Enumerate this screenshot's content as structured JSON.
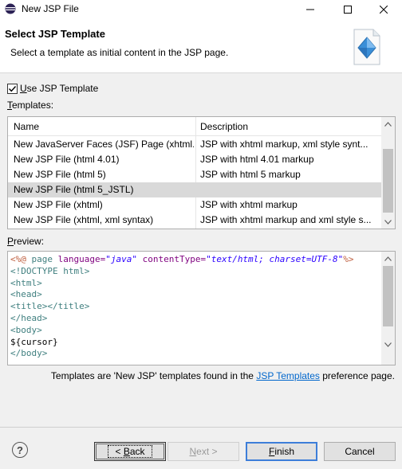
{
  "window": {
    "title": "New JSP File"
  },
  "banner": {
    "heading": "Select JSP Template",
    "description": "Select a template as initial content in the JSP page."
  },
  "use_template": {
    "label_prefix": "U",
    "label_rest": "se JSP Template",
    "checked": true
  },
  "templates_label": {
    "prefix": "T",
    "rest": "emplates:"
  },
  "table": {
    "columns": [
      "Name",
      "Description"
    ],
    "rows": [
      {
        "name": "New JavaServer Faces (JSF) Page (xhtml...",
        "description": "JSP with xhtml markup, xml style synt...",
        "selected": false
      },
      {
        "name": "New JSP File (html 4.01)",
        "description": "JSP with html 4.01 markup",
        "selected": false
      },
      {
        "name": "New JSP File (html 5)",
        "description": "JSP with html 5 markup",
        "selected": false
      },
      {
        "name": "New JSP File (html 5_JSTL)",
        "description": "",
        "selected": true
      },
      {
        "name": "New JSP File (xhtml)",
        "description": "JSP with xhtml markup",
        "selected": false
      },
      {
        "name": "New JSP File (xhtml, xml syntax)",
        "description": "JSP with xhtml markup and xml style s...",
        "selected": false
      }
    ]
  },
  "preview_label": {
    "prefix": "P",
    "rest": "review:"
  },
  "preview": {
    "l1_open": "<%@",
    "l1_kw": " page ",
    "l1_attr1": "language=",
    "l1_val1": "\"java\"",
    "l1_attr2": " contentType=",
    "l1_val2": "\"text/html; charset=UTF-8\"",
    "l1_close": "%>",
    "l2": "<!DOCTYPE html>",
    "l3": "<html>",
    "l4": "<head>",
    "l5": "<title></title>",
    "l6": "</head>",
    "l7": "<body>",
    "l8": "${cursor}",
    "l9": "</body>"
  },
  "info": {
    "before": "Templates are 'New JSP' templates found in the ",
    "link": "JSP Templates",
    "after": " preference page."
  },
  "buttons": {
    "back": {
      "prefix": "< ",
      "mnemonic": "B",
      "rest": "ack"
    },
    "next": {
      "mnemonic": "N",
      "rest": "ext >"
    },
    "finish": {
      "mnemonic": "F",
      "rest": "inish"
    },
    "cancel": "Cancel",
    "help": "?"
  }
}
